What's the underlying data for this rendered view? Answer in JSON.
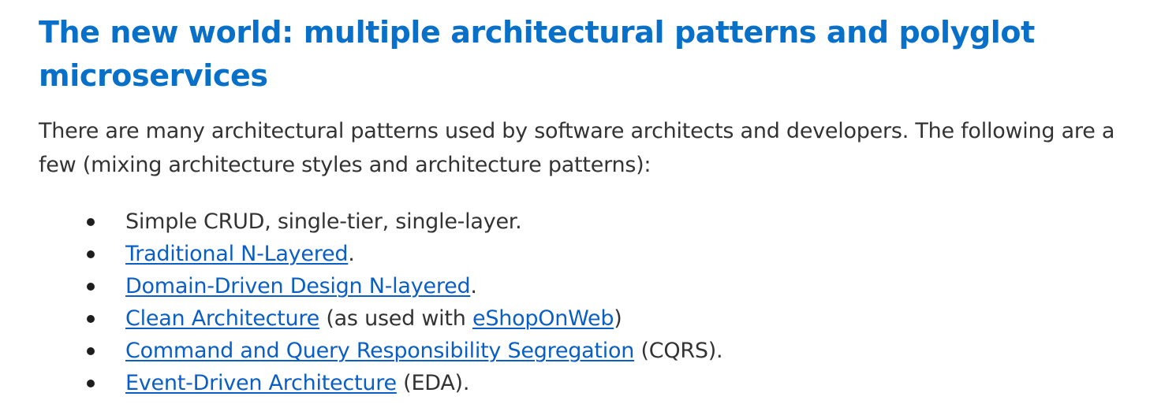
{
  "heading": {
    "title": "The new world: multiple architectural patterns and polyglot microservices"
  },
  "intro": {
    "text": "There are many architectural patterns used by software architects and developers. The following are a few (mixing architecture styles and architecture patterns):"
  },
  "patterns": [
    {
      "pre": "Simple CRUD, single-tier, single-layer.",
      "link": "",
      "mid": "",
      "link2": "",
      "post": ""
    },
    {
      "pre": "",
      "link": "Traditional N-Layered",
      "mid": "",
      "link2": "",
      "post": "."
    },
    {
      "pre": "",
      "link": "Domain-Driven Design N-layered",
      "mid": "",
      "link2": "",
      "post": "."
    },
    {
      "pre": "",
      "link": "Clean Architecture",
      "mid": " (as used with ",
      "link2": "eShopOnWeb",
      "post": ")"
    },
    {
      "pre": "",
      "link": "Command and Query Responsibility Segregation",
      "mid": "",
      "link2": "",
      "post": " (CQRS)."
    },
    {
      "pre": "",
      "link": "Event-Driven Architecture",
      "mid": "",
      "link2": "",
      "post": " (EDA)."
    }
  ],
  "colors": {
    "heading": "#0870c8",
    "link": "#0b5fc4",
    "body_text": "#333333",
    "bullet": "#1e1e1e"
  }
}
